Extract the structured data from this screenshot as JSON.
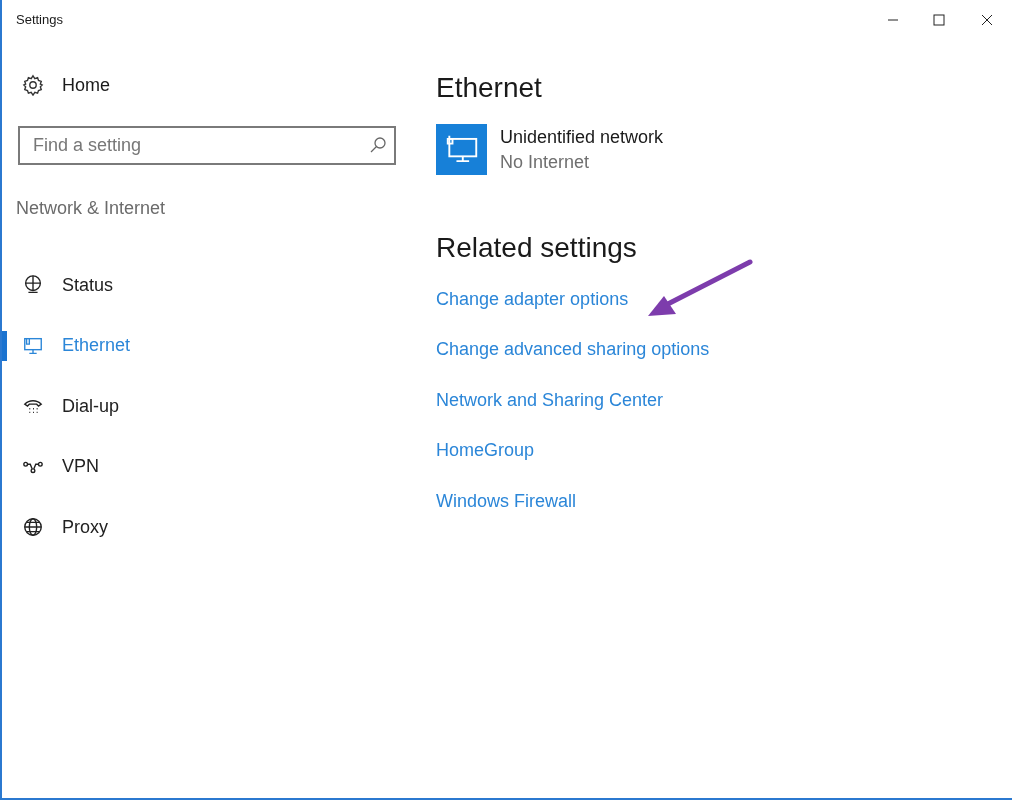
{
  "window": {
    "title": "Settings"
  },
  "sidebar": {
    "home": "Home",
    "search": {
      "placeholder": "Find a setting"
    },
    "category": "Network & Internet",
    "items": [
      {
        "label": "Status",
        "kind": "status",
        "selected": false
      },
      {
        "label": "Ethernet",
        "kind": "ethernet",
        "selected": true
      },
      {
        "label": "Dial-up",
        "kind": "dialup",
        "selected": false
      },
      {
        "label": "VPN",
        "kind": "vpn",
        "selected": false
      },
      {
        "label": "Proxy",
        "kind": "proxy",
        "selected": false
      }
    ]
  },
  "content": {
    "heading": "Ethernet",
    "network": {
      "name": "Unidentified network",
      "status": "No Internet"
    },
    "related_heading": "Related settings",
    "links": [
      "Change adapter options",
      "Change advanced sharing options",
      "Network and Sharing Center",
      "HomeGroup",
      "Windows Firewall"
    ]
  }
}
